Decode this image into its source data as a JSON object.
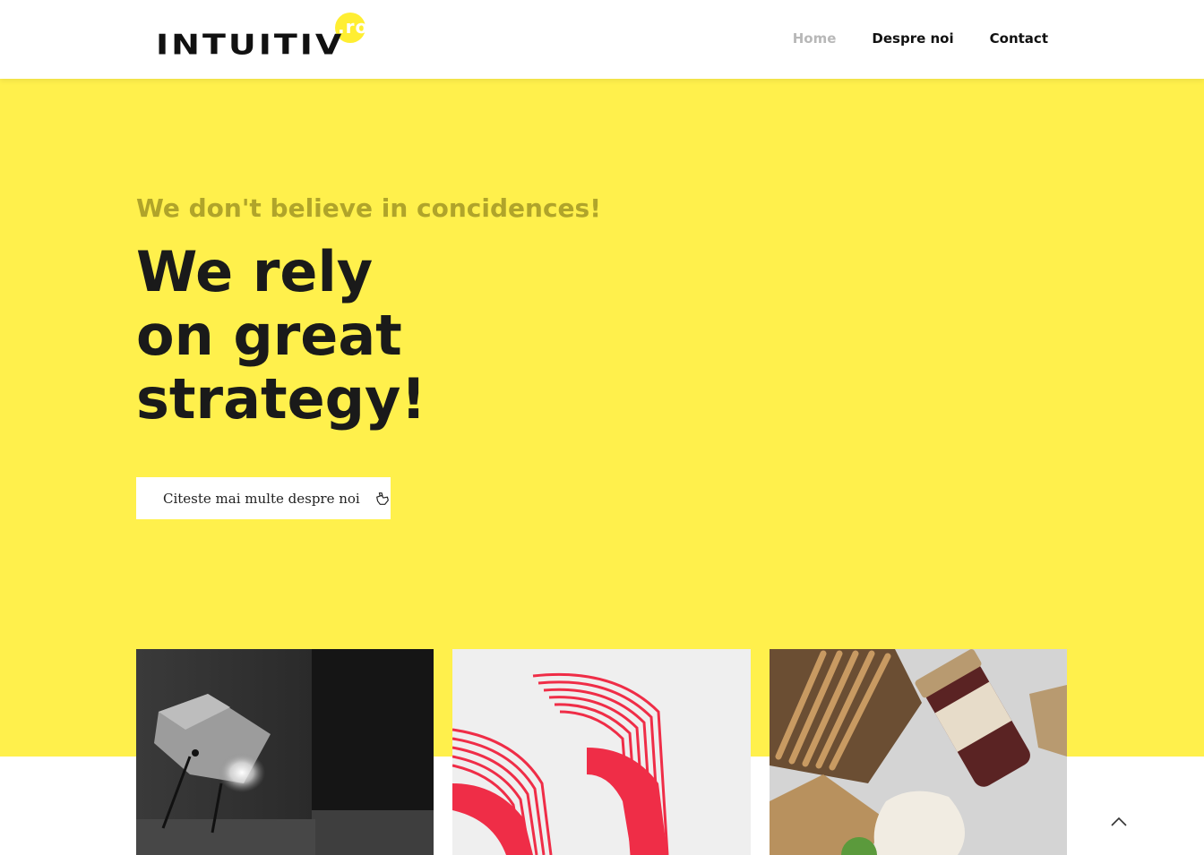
{
  "header": {
    "logo_text": "INTUITIV",
    "logo_suffix": ".ro",
    "nav": [
      {
        "label": "Home",
        "active": true
      },
      {
        "label": "Despre noi",
        "active": false
      },
      {
        "label": "Contact",
        "active": false
      }
    ]
  },
  "hero": {
    "tagline": "We don't believe in concidences!",
    "headline_lines": [
      "We rely",
      "on great",
      "strategy!"
    ],
    "cta_label": "Citeste mai multe despre noi",
    "background_color": "#fff04c"
  },
  "icons": {
    "cta": "hand-point-icon",
    "scroll_top": "chevron-up-icon"
  }
}
